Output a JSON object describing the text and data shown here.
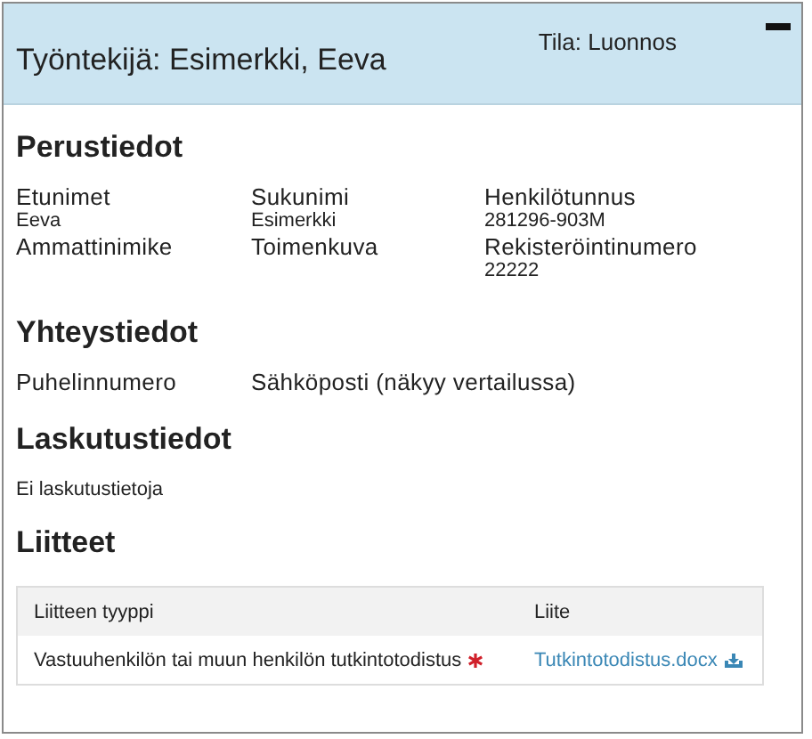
{
  "header": {
    "title": "Työntekijä: Esimerkki, Eeva",
    "status": "Tila: Luonnos",
    "expanded": true
  },
  "basic_info": {
    "heading": "Perustiedot",
    "fields": [
      {
        "label": "Etunimet",
        "value": "Eeva"
      },
      {
        "label": "Sukunimi",
        "value": "Esimerkki"
      },
      {
        "label": "Henkilötunnus",
        "value": "281296-903M"
      },
      {
        "label": "Ammattinimike"
      },
      {
        "label": "Toimenkuva"
      },
      {
        "label": "Rekisteröintinumero",
        "value": "22222"
      }
    ]
  },
  "contact_info": {
    "heading": "Yhteystiedot",
    "fields": [
      {
        "label": "Puhelinnumero"
      },
      {
        "label": "Sähköposti (näkyy vertailussa)"
      }
    ]
  },
  "billing_info": {
    "heading": "Laskutustiedot",
    "text": "Ei laskutustietoja"
  },
  "attachments": {
    "heading": "Liitteet",
    "columns": [
      "Liitteen tyyppi",
      "Liite"
    ],
    "rows": [
      {
        "type": "Vastuuhenkilön tai muun henkilön tutkintotodistus",
        "required": true,
        "file": "Tutkintotodistus.docx"
      }
    ]
  }
}
